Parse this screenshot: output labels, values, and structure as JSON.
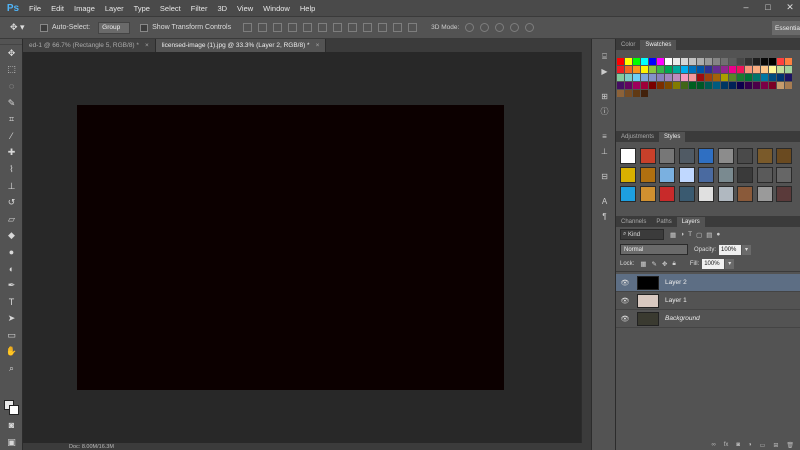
{
  "app": {
    "logo": "Ps"
  },
  "menu": [
    "File",
    "Edit",
    "Image",
    "Layer",
    "Type",
    "Select",
    "Filter",
    "3D",
    "View",
    "Window",
    "Help"
  ],
  "window_controls": {
    "minimize": "–",
    "maximize": "□",
    "close": "✕"
  },
  "options_bar": {
    "auto_select_label": "Auto-Select:",
    "auto_select_value": "Group",
    "show_transform_label": "Show Transform Controls",
    "mode_3d_label": "3D Mode:",
    "workspace_label": "Essentials"
  },
  "doc_tabs": [
    {
      "label": "ed-1 @ 66.7% (Rectangle 5, RGB/8) *",
      "close": "×"
    },
    {
      "label": "licensed-image (1).jpg @ 33.3% (Layer 2, RGB/8) *",
      "close": "×"
    }
  ],
  "status_bar": {
    "zoom": "",
    "doc": "Doc: 8.00M/16.3M"
  },
  "color_panel": {
    "tabs": [
      "Color",
      "Swatches"
    ],
    "active": "Swatches"
  },
  "swatches": [
    "#ff0000",
    "#ffff00",
    "#00ff00",
    "#00ffff",
    "#0000ff",
    "#ff00ff",
    "#ffffff",
    "#ebebeb",
    "#d6d6d6",
    "#c2c2c2",
    "#adadad",
    "#999999",
    "#858585",
    "#707070",
    "#5c5c5c",
    "#474747",
    "#333333",
    "#1f1f1f",
    "#0a0a0a",
    "#000000",
    "#ff4040",
    "#ff8040",
    "#ed1c24",
    "#f26522",
    "#f7941d",
    "#fff200",
    "#8dc63f",
    "#39b54a",
    "#00a651",
    "#00a99d",
    "#00aeef",
    "#0072bc",
    "#0054a6",
    "#2e3192",
    "#662d91",
    "#92278f",
    "#ec008c",
    "#ed145b",
    "#f69679",
    "#f9ad81",
    "#fdc68a",
    "#fff799",
    "#c4df9b",
    "#a3d39c",
    "#82ca9c",
    "#7accc8",
    "#6dcff6",
    "#7da7d9",
    "#8393ca",
    "#8781bd",
    "#a186be",
    "#bd8cbf",
    "#f49ac1",
    "#f5989d",
    "#9e0b0f",
    "#a0410d",
    "#a36209",
    "#aba000",
    "#598527",
    "#1a7b30",
    "#007236",
    "#00746b",
    "#0076a3",
    "#004b80",
    "#003471",
    "#1b1464",
    "#440e62",
    "#630460",
    "#9e005d",
    "#9e0039",
    "#790000",
    "#7b2e00",
    "#7d4900",
    "#827b00",
    "#406618",
    "#005e20",
    "#005826",
    "#005952",
    "#005b7f",
    "#003663",
    "#002157",
    "#0d004c",
    "#32004b",
    "#4b0049",
    "#7b0046",
    "#7a0026",
    "#c69c6d",
    "#a67c52",
    "#8c6239",
    "#754c24",
    "#603913",
    "#42210b"
  ],
  "adjustments_panel": {
    "tabs": [
      "Adjustments",
      "Styles"
    ],
    "active": "Styles"
  },
  "styles": [
    "#ffffff",
    "#c8402a",
    "#777777",
    "#505a64",
    "#2f6fc2",
    "#8c8c8c",
    "#4a4a4a",
    "#7a5a2a",
    "#6a4a20",
    "#d8b000",
    "#b07010",
    "#7ab0e0",
    "#c0d8ff",
    "#4a6aa0",
    "#7a8a90",
    "#3a3a3a",
    "#5a5a5a",
    "#666666",
    "#1d9fe0",
    "#d09030",
    "#c82a2a",
    "#3a5a70",
    "#e0e0e0",
    "#b0b8c0",
    "#8a5a3a",
    "#9a9a9a",
    "#5a3a3a"
  ],
  "layers_panel": {
    "tabs": [
      "Channels",
      "Paths",
      "Layers"
    ],
    "active": "Layers",
    "kind_label": "Kind",
    "blend_mode": "Normal",
    "opacity_label": "Opacity:",
    "opacity_value": "100%",
    "lock_label": "Lock:",
    "fill_label": "Fill:",
    "fill_value": "100%",
    "layers": [
      {
        "name": "Layer 2",
        "selected": true,
        "italic": false,
        "thumb": "#000000"
      },
      {
        "name": "Layer 1",
        "selected": false,
        "italic": false,
        "thumb": "#d8c8c0"
      },
      {
        "name": "Background",
        "selected": false,
        "italic": true,
        "thumb": "#3a3a30"
      }
    ]
  },
  "colors": {
    "canvas": "#0c0000",
    "selection": "#5d6e84",
    "logo": "#4fb3f6"
  }
}
